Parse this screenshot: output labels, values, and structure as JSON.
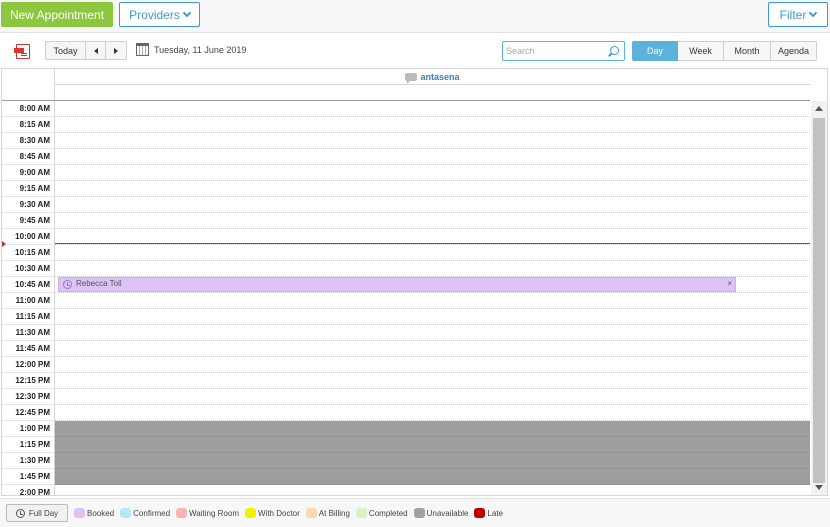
{
  "header": {
    "new_appointment_label": "New Appointment",
    "providers_label": "Providers",
    "filter_label": "Filter"
  },
  "toolbar": {
    "today_label": "Today",
    "date_text": "Tuesday, 11 June 2019",
    "search_placeholder": "Search",
    "views": [
      {
        "label": "Day",
        "active": true
      },
      {
        "label": "Week",
        "active": false
      },
      {
        "label": "Month",
        "active": false
      },
      {
        "label": "Agenda",
        "active": false
      }
    ]
  },
  "calendar": {
    "resource_name": "antasena",
    "time_slots": [
      "8:00 AM",
      "8:15 AM",
      "8:30 AM",
      "8:45 AM",
      "9:00 AM",
      "9:15 AM",
      "9:30 AM",
      "9:45 AM",
      "10:00 AM",
      "10:15 AM",
      "10:30 AM",
      "10:45 AM",
      "11:00 AM",
      "11:15 AM",
      "11:30 AM",
      "11:45 AM",
      "12:00 PM",
      "12:15 PM",
      "12:30 PM",
      "12:45 PM",
      "1:00 PM",
      "1:15 PM",
      "1:30 PM",
      "1:45 PM",
      "2:00 PM"
    ],
    "unavailable_slots": [
      "1:00 PM",
      "1:15 PM",
      "1:30 PM",
      "1:45 PM"
    ],
    "current_time_slot": "10:15 AM",
    "appointments": [
      {
        "patient": "Rebecca Toll",
        "slot": "10:45 AM",
        "status": "Booked",
        "close_label": "×"
      }
    ]
  },
  "legend": {
    "full_day_label": "Full Day",
    "items": [
      {
        "label": "Booked",
        "color": "#dcc2f5"
      },
      {
        "label": "Confirmed",
        "color": "#b6e6f7"
      },
      {
        "label": "Waiting Room",
        "color": "#f7b6b6"
      },
      {
        "label": "With Doctor",
        "color": "#f2f200"
      },
      {
        "label": "At Billing",
        "color": "#f9d9b0"
      },
      {
        "label": "Completed",
        "color": "#d9f2c2"
      },
      {
        "label": "Unavailable",
        "color": "#a0a0a0"
      },
      {
        "label": "Late",
        "color": "#c00000"
      }
    ]
  },
  "colors": {
    "accent_green": "#8dc63f",
    "accent_blue": "#3a9bd5",
    "now_line": "#c0392b"
  }
}
